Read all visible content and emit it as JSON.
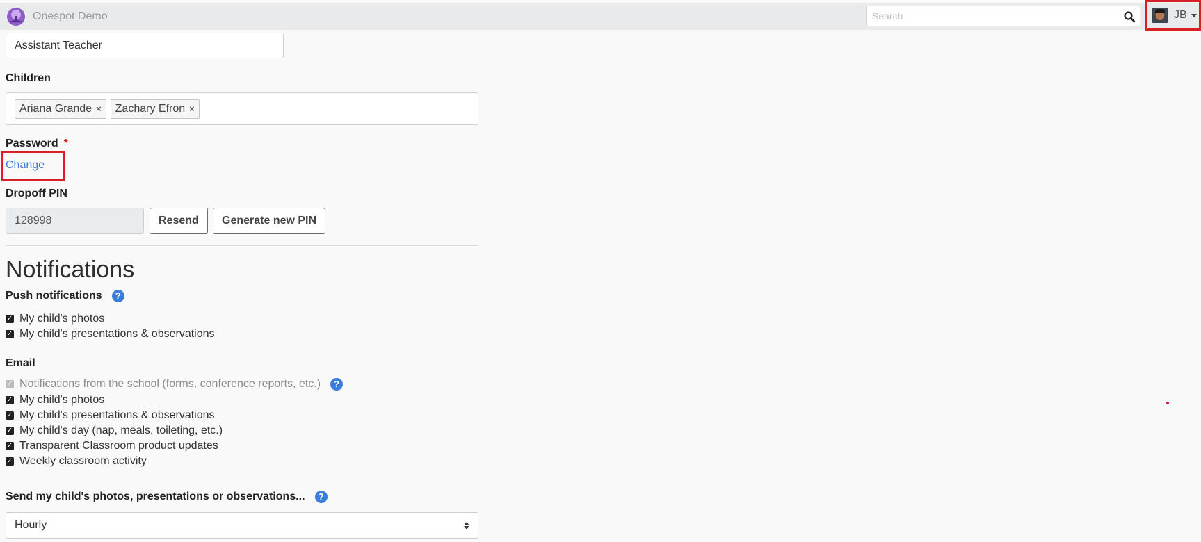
{
  "app": {
    "title": "Onespot Demo"
  },
  "search": {
    "placeholder": "Search",
    "value": ""
  },
  "user": {
    "initials": "JB"
  },
  "role": {
    "value": "Assistant Teacher"
  },
  "children": {
    "label": "Children",
    "tags": [
      "Ariana Grande",
      "Zachary Efron"
    ],
    "remove_symbol": "×"
  },
  "password": {
    "label": "Password",
    "required_marker": "*",
    "change_link": "Change"
  },
  "dropoff": {
    "label": "Dropoff PIN",
    "pin": "128998",
    "resend_label": "Resend",
    "generate_label": "Generate new PIN"
  },
  "notifications": {
    "heading": "Notifications",
    "push": {
      "label": "Push notifications",
      "help": "?",
      "items": [
        {
          "label": "My child's photos",
          "checked": true
        },
        {
          "label": "My child's presentations & observations",
          "checked": true
        }
      ]
    },
    "email": {
      "label": "Email",
      "help": "?",
      "items": [
        {
          "label": "Notifications from the school (forms, conference reports, etc.)",
          "checked": true,
          "disabled": true
        },
        {
          "label": "My child's photos",
          "checked": true
        },
        {
          "label": "My child's presentations & observations",
          "checked": true
        },
        {
          "label": "My child's day (nap, meals, toileting, etc.)",
          "checked": true
        },
        {
          "label": "Transparent Classroom product updates",
          "checked": true
        },
        {
          "label": "Weekly classroom activity",
          "checked": true
        }
      ]
    },
    "frequency": {
      "label": "Send my child's photos, presentations or observations...",
      "help": "?",
      "selected": "Hourly"
    }
  },
  "colors": {
    "accent": "#3b7ddd",
    "highlight": "#d81f26",
    "navbar": "#e9eaec"
  }
}
